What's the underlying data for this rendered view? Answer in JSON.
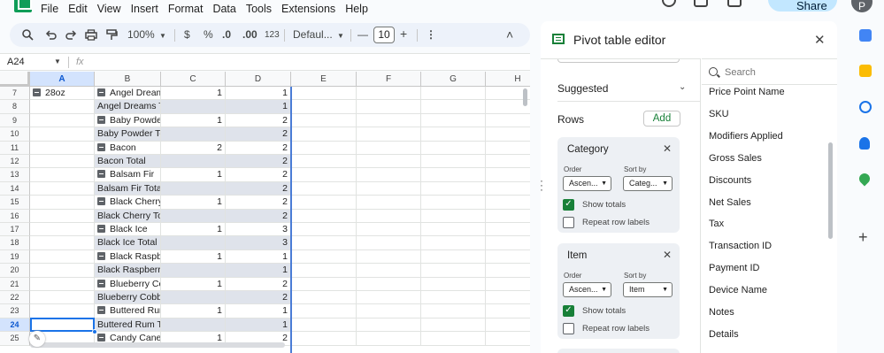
{
  "menubar": {
    "items": [
      "File",
      "Edit",
      "View",
      "Insert",
      "Format",
      "Data",
      "Tools",
      "Extensions",
      "Help"
    ],
    "share_label": "Share",
    "avatar_letter": "P"
  },
  "toolbar": {
    "zoom": "100%",
    "currency": "$",
    "percent": "%",
    "dec_decrease": ".0",
    "dec_increase": ".00",
    "number_format": "123",
    "font": "Defaul...",
    "font_size": "10",
    "minus": "—",
    "plus": "+",
    "more": "⋮",
    "collapse": "˄"
  },
  "formula_bar": {
    "cell_ref": "A24",
    "fx": "fx",
    "value": ""
  },
  "grid": {
    "columns": [
      "A",
      "B",
      "C",
      "D",
      "E",
      "F",
      "G",
      "H"
    ],
    "selected_column": "A",
    "selected_row": "24",
    "rows": [
      {
        "num": "7",
        "a": "28oz",
        "b": "Angel Dreams",
        "c": "1",
        "d": "1",
        "total": false
      },
      {
        "num": "8",
        "a": "",
        "b": "Angel Dreams Total",
        "c": "",
        "d": "1",
        "total": true
      },
      {
        "num": "9",
        "a": "",
        "b": "Baby Powder",
        "c": "1",
        "d": "2",
        "total": false
      },
      {
        "num": "10",
        "a": "",
        "b": "Baby Powder Total",
        "c": "",
        "d": "2",
        "total": true
      },
      {
        "num": "11",
        "a": "",
        "b": "Bacon",
        "c": "2",
        "d": "2",
        "total": false
      },
      {
        "num": "12",
        "a": "",
        "b": "Bacon Total",
        "c": "",
        "d": "2",
        "total": true
      },
      {
        "num": "13",
        "a": "",
        "b": "Balsam Fir",
        "c": "1",
        "d": "2",
        "total": false
      },
      {
        "num": "14",
        "a": "",
        "b": "Balsam Fir Total",
        "c": "",
        "d": "2",
        "total": true
      },
      {
        "num": "15",
        "a": "",
        "b": "Black Cherry",
        "c": "1",
        "d": "2",
        "total": false
      },
      {
        "num": "16",
        "a": "",
        "b": "Black Cherry Total",
        "c": "",
        "d": "2",
        "total": true
      },
      {
        "num": "17",
        "a": "",
        "b": "Black Ice",
        "c": "1",
        "d": "3",
        "total": false
      },
      {
        "num": "18",
        "a": "",
        "b": "Black Ice Total",
        "c": "",
        "d": "3",
        "total": true
      },
      {
        "num": "19",
        "a": "",
        "b": "Black Raspbe",
        "c": "1",
        "d": "1",
        "total": false
      },
      {
        "num": "20",
        "a": "",
        "b": "Black Raspberry Total",
        "c": "",
        "d": "1",
        "total": true
      },
      {
        "num": "21",
        "a": "",
        "b": "Blueberry Col",
        "c": "1",
        "d": "2",
        "total": false
      },
      {
        "num": "22",
        "a": "",
        "b": "Blueberry Cobbler Total",
        "c": "",
        "d": "2",
        "total": true
      },
      {
        "num": "23",
        "a": "",
        "b": "Buttered Rum",
        "c": "1",
        "d": "1",
        "total": false
      },
      {
        "num": "24",
        "a": "",
        "b": "Buttered Rum Total",
        "c": "",
        "d": "1",
        "total": true
      },
      {
        "num": "25",
        "a": "",
        "b": "Candy Cane",
        "c": "1",
        "d": "2",
        "total": false
      }
    ]
  },
  "pivot_editor": {
    "title": "Pivot table editor",
    "suggested_label": "Suggested",
    "rows_label": "Rows",
    "add_label": "Add",
    "cards": [
      {
        "title": "Category",
        "order_label": "Order",
        "order_value": "Ascen...",
        "sortby_label": "Sort by",
        "sortby_value": "Categ...",
        "show_totals": "Show totals",
        "show_totals_checked": true,
        "repeat_labels": "Repeat row labels",
        "repeat_checked": false
      },
      {
        "title": "Item",
        "order_label": "Order",
        "order_value": "Ascen...",
        "sortby_label": "Sort by",
        "sortby_value": "Item",
        "show_totals": "Show totals",
        "show_totals_checked": true,
        "repeat_labels": "Repeat row labels",
        "repeat_checked": false
      }
    ],
    "search_placeholder": "Search",
    "fields": [
      "Price Point Name",
      "SKU",
      "Modifiers Applied",
      "Gross Sales",
      "Discounts",
      "Net Sales",
      "Tax",
      "Transaction ID",
      "Payment ID",
      "Device Name",
      "Notes",
      "Details"
    ]
  },
  "colors": {
    "accent_green": "#188038",
    "selection_blue": "#1a73e8",
    "pivot_total_bg": "#dfe3eb"
  }
}
